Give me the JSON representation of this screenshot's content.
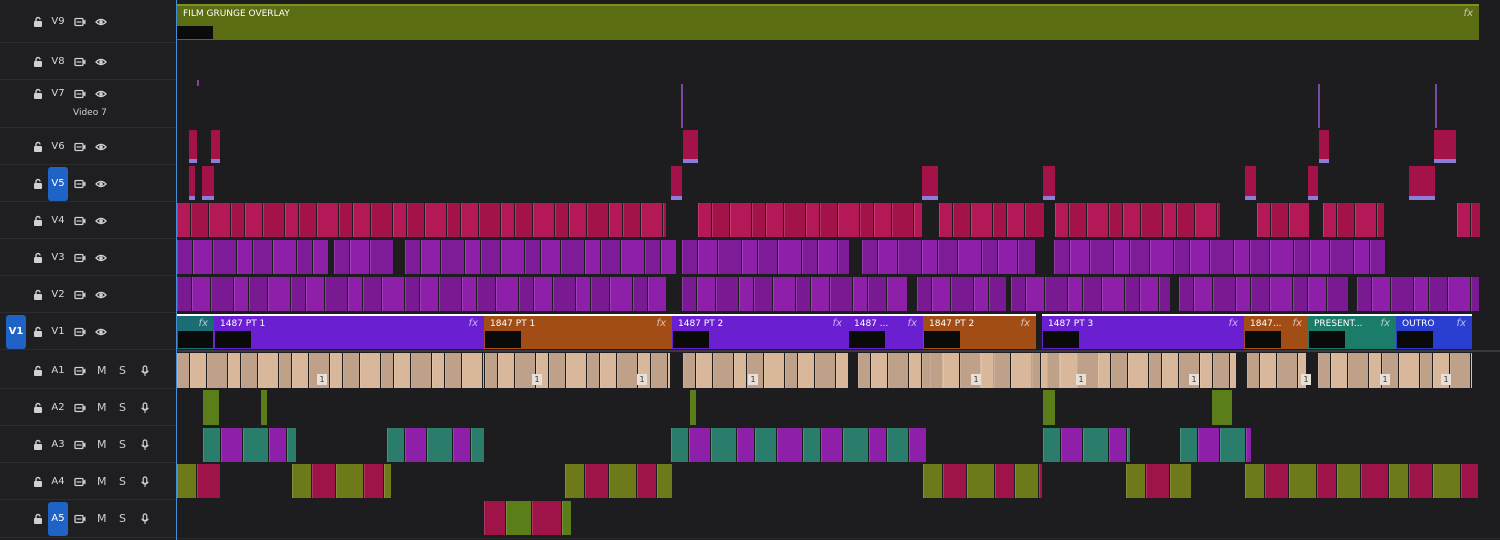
{
  "video_tracks": [
    {
      "name": "V9",
      "sub": "",
      "source": "",
      "active": false
    },
    {
      "name": "V8",
      "sub": "",
      "source": "",
      "active": false
    },
    {
      "name": "V7",
      "sub": "Video 7",
      "source": "",
      "active": false
    },
    {
      "name": "V6",
      "sub": "",
      "source": "",
      "active": false
    },
    {
      "name": "V5",
      "sub": "",
      "source": "",
      "active": true
    },
    {
      "name": "V4",
      "sub": "",
      "source": "",
      "active": false
    },
    {
      "name": "V3",
      "sub": "",
      "source": "",
      "active": false
    },
    {
      "name": "V2",
      "sub": "",
      "source": "",
      "active": false
    },
    {
      "name": "V1",
      "sub": "",
      "source": "V1",
      "active": false
    }
  ],
  "audio_tracks": [
    {
      "name": "A1",
      "active": false
    },
    {
      "name": "A2",
      "active": false
    },
    {
      "name": "A3",
      "active": false
    },
    {
      "name": "A4",
      "active": false
    },
    {
      "name": "A5",
      "active": true
    }
  ],
  "audio_buttons": {
    "mute": "M",
    "solo": "S"
  },
  "overlay_clip": {
    "label": "FILM GRUNGE OVERLAY",
    "fx": "fx",
    "color": "#5b6d12"
  },
  "v1_clips": [
    {
      "label": "",
      "color": "#1a6c75",
      "fx": "fx"
    },
    {
      "label": "1487 PT 1",
      "color": "#6a1fd0",
      "fx": "fx"
    },
    {
      "label": "1847 PT 1",
      "color": "#a24d16",
      "fx": "fx"
    },
    {
      "label": "1487 PT 2",
      "color": "#6a1fd0",
      "fx": "fx"
    },
    {
      "label": "1487 ...",
      "color": "#6a1fd0",
      "fx": "fx"
    },
    {
      "label": "1847 PT 2",
      "color": "#a24d16",
      "fx": "fx"
    },
    {
      "label": "1487 PT 3",
      "color": "#6a1fd0",
      "fx": "fx"
    },
    {
      "label": "1847...",
      "color": "#a24d16",
      "fx": "fx"
    },
    {
      "label": "PRESENT...",
      "color": "#1c7c6a",
      "fx": "fx"
    },
    {
      "label": "OUTRO",
      "color": "#2a3fcf",
      "fx": "fx"
    }
  ],
  "a1_clip_marker": "1",
  "colors": {
    "magenta": "#a3134a",
    "purple": "#8e1fa8",
    "violet": "#6a1fd0",
    "orange": "#a24d16",
    "teal": "#1c7c6a",
    "audio_tan": "#d8b79a",
    "green": "#5b7d1a",
    "playhead": "#4aa3ff",
    "accent": "#1f63c6"
  },
  "icons": [
    "lock-icon",
    "film-icon",
    "eye-icon",
    "mic-icon",
    "fx-icon"
  ]
}
